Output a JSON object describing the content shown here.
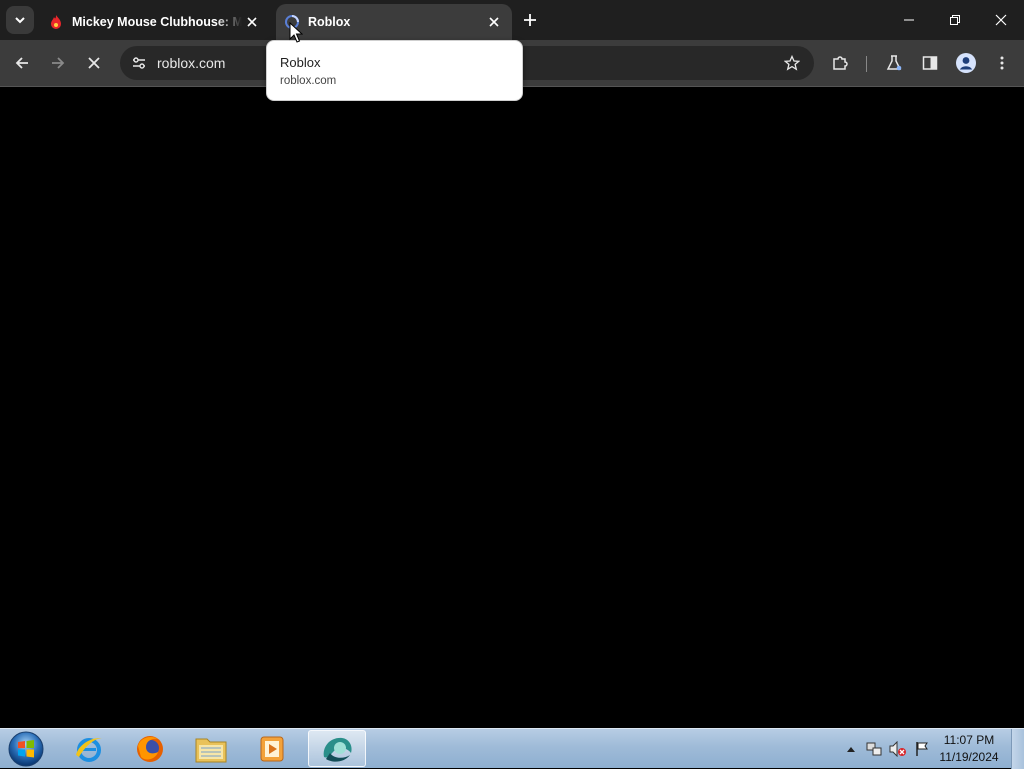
{
  "browser": {
    "tabs": [
      {
        "title": "Mickey Mouse Clubhouse: Mic",
        "favicon": "red-flame-icon",
        "active": false
      },
      {
        "title": "Roblox",
        "favicon": "loading-spinner-icon",
        "active": true
      }
    ],
    "address": "roblox.com",
    "tooltip": {
      "title": "Roblox",
      "url": "roblox.com"
    },
    "colors": {
      "tabstrip": "#1f1f1f",
      "toolbar": "#3c3c3c",
      "omnibox": "#282828",
      "content": "#000000"
    }
  },
  "taskbar": {
    "apps": [
      {
        "name": "internet-explorer-icon"
      },
      {
        "name": "firefox-icon"
      },
      {
        "name": "file-explorer-icon"
      },
      {
        "name": "media-player-icon"
      },
      {
        "name": "chrome-beta-icon",
        "active": true
      }
    ],
    "clock": {
      "time": "11:07 PM",
      "date": "11/19/2024"
    }
  }
}
